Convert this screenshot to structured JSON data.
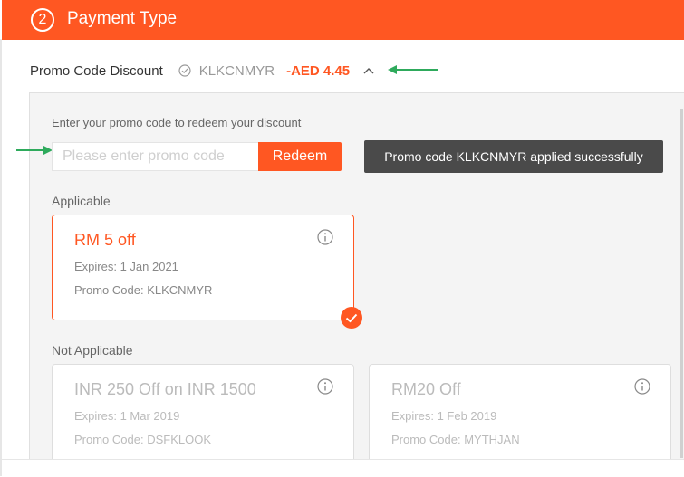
{
  "header": {
    "step_number": "2",
    "title": "Payment Type"
  },
  "summary": {
    "label": "Promo Code Discount",
    "applied_code": "KLKCNMYR",
    "discount_amount": "-AED 4.45",
    "toggle_icon": "chevron-up-icon",
    "check_icon": "check-circle-icon"
  },
  "promo": {
    "hint": "Enter your promo code to redeem your discount",
    "input_value": "",
    "input_placeholder": "Please enter promo code",
    "redeem_label": "Redeem",
    "toast_message": "Promo code KLKCNMYR applied successfully"
  },
  "applicable": {
    "label": "Applicable",
    "coupons": [
      {
        "title": "RM 5 off",
        "expiry": "Expires: 1 Jan 2021",
        "code": "Promo Code: KLKCNMYR",
        "selected": true
      }
    ]
  },
  "not_applicable": {
    "label": "Not Applicable",
    "coupons": [
      {
        "title": "INR 250 Off on INR 1500",
        "expiry": "Expires: 1 Mar 2019",
        "code": "Promo Code: DSFKLOOK"
      },
      {
        "title": "RM20 Off",
        "expiry": "Expires: 1 Feb 2019",
        "code": "Promo Code: MYTHJAN"
      }
    ]
  },
  "colors": {
    "brand": "#ff5722",
    "annotation_arrow": "#2eaa5c",
    "toast_bg": "#4a4a4a"
  }
}
